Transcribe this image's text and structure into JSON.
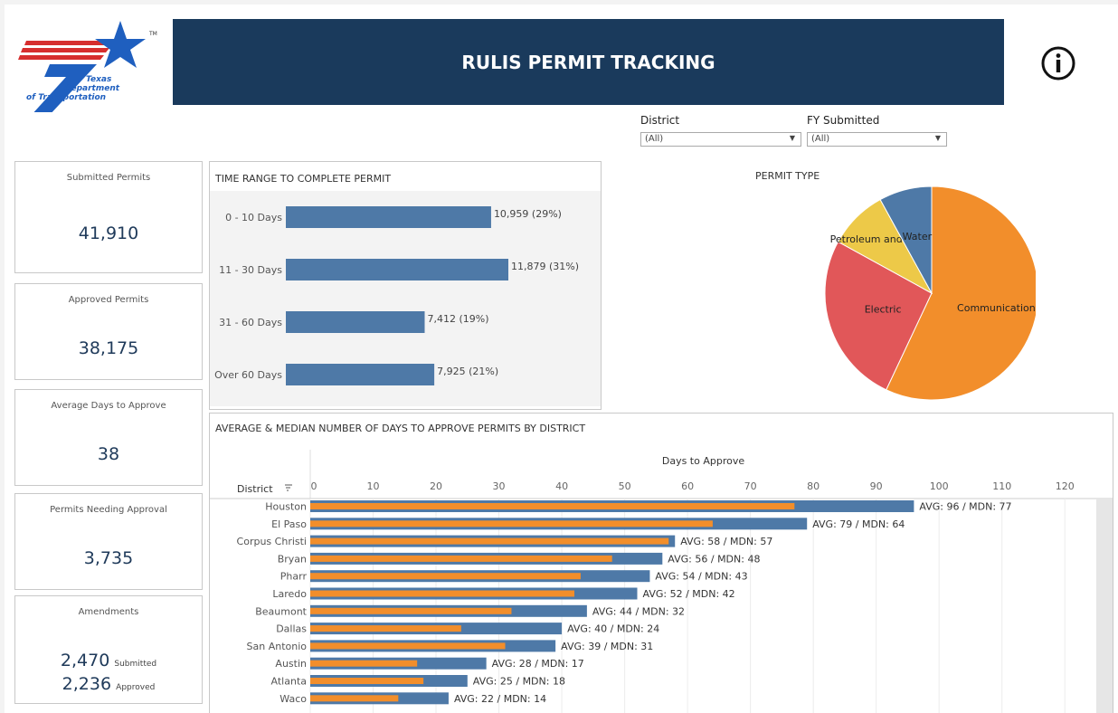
{
  "header": {
    "title": "RULIS PERMIT TRACKING",
    "logo_lines": [
      "Texas",
      "Department",
      "of Transportation"
    ],
    "logo_tm": "TM",
    "info_icon": "info-circle-icon",
    "banner_color": "#1a3a5c"
  },
  "filters": {
    "district": {
      "label": "District",
      "value": "(All)"
    },
    "fy_submitted": {
      "label": "FY Submitted",
      "value": "(All)"
    }
  },
  "kpis": {
    "submitted": {
      "label": "Submitted Permits",
      "value": "41,910"
    },
    "approved": {
      "label": "Approved Permits",
      "value": "38,175"
    },
    "avg_days": {
      "label": "Average Days to Approve",
      "value": "38"
    },
    "needing": {
      "label": "Permits Needing Approval",
      "value": "3,735"
    },
    "amendments": {
      "label": "Amendments",
      "submitted_value": "2,470",
      "submitted_label": "Submitted",
      "approved_value": "2,236",
      "approved_label": "Approved"
    }
  },
  "chart_data": [
    {
      "type": "bar",
      "orientation": "horizontal",
      "title": "TIME RANGE TO COMPLETE PERMIT",
      "categories": [
        "0 - 10 Days",
        "11 - 30 Days",
        "31 - 60 Days",
        "Over 60 Days"
      ],
      "values": [
        10959,
        11879,
        7412,
        7925
      ],
      "data_labels": [
        "10,959 (29%)",
        "11,879 (31%)",
        "7,412 (19%)",
        "7,925 (21%)"
      ],
      "color": "#4e79a7"
    },
    {
      "type": "pie",
      "title": "PERMIT TYPE",
      "slices": [
        {
          "name": "Communication",
          "value": 57,
          "color": "#f28e2b"
        },
        {
          "name": "Electric",
          "value": 26,
          "color": "#e15759"
        },
        {
          "name": "Petroleum and Gas",
          "value": 9,
          "color": "#edc948"
        },
        {
          "name": "Water",
          "value": 8,
          "color": "#4e79a7"
        }
      ]
    },
    {
      "type": "bar",
      "orientation": "horizontal",
      "title": "AVERAGE & MEDIAN NUMBER OF DAYS TO APPROVE PERMITS BY DISTRICT",
      "xlabel": "Days to Approve",
      "ylabel": "District",
      "xlim": [
        0,
        125
      ],
      "xticks": [
        0,
        10,
        20,
        30,
        40,
        50,
        60,
        70,
        80,
        90,
        100,
        110,
        120
      ],
      "categories": [
        "Houston",
        "El Paso",
        "Corpus Christi",
        "Bryan",
        "Pharr",
        "Laredo",
        "Beaumont",
        "Dallas",
        "San Antonio",
        "Austin",
        "Atlanta",
        "Waco"
      ],
      "series": [
        {
          "name": "AVG",
          "values": [
            96,
            79,
            58,
            56,
            54,
            52,
            44,
            40,
            39,
            28,
            25,
            22
          ],
          "color": "#4e79a7"
        },
        {
          "name": "MDN",
          "values": [
            77,
            64,
            57,
            48,
            43,
            42,
            32,
            24,
            31,
            17,
            18,
            14
          ],
          "color": "#f28e2b"
        }
      ],
      "data_labels": [
        "AVG: 96 / MDN: 77",
        "AVG: 79 / MDN: 64",
        "AVG: 58 / MDN: 57",
        "AVG: 56 / MDN: 48",
        "AVG: 54 / MDN: 43",
        "AVG: 52 / MDN: 42",
        "AVG: 44 / MDN: 32",
        "AVG: 40 / MDN: 24",
        "AVG: 39 / MDN: 31",
        "AVG: 28 / MDN: 17",
        "AVG: 25 / MDN: 18",
        "AVG: 22 / MDN: 14"
      ],
      "grid": true
    }
  ]
}
